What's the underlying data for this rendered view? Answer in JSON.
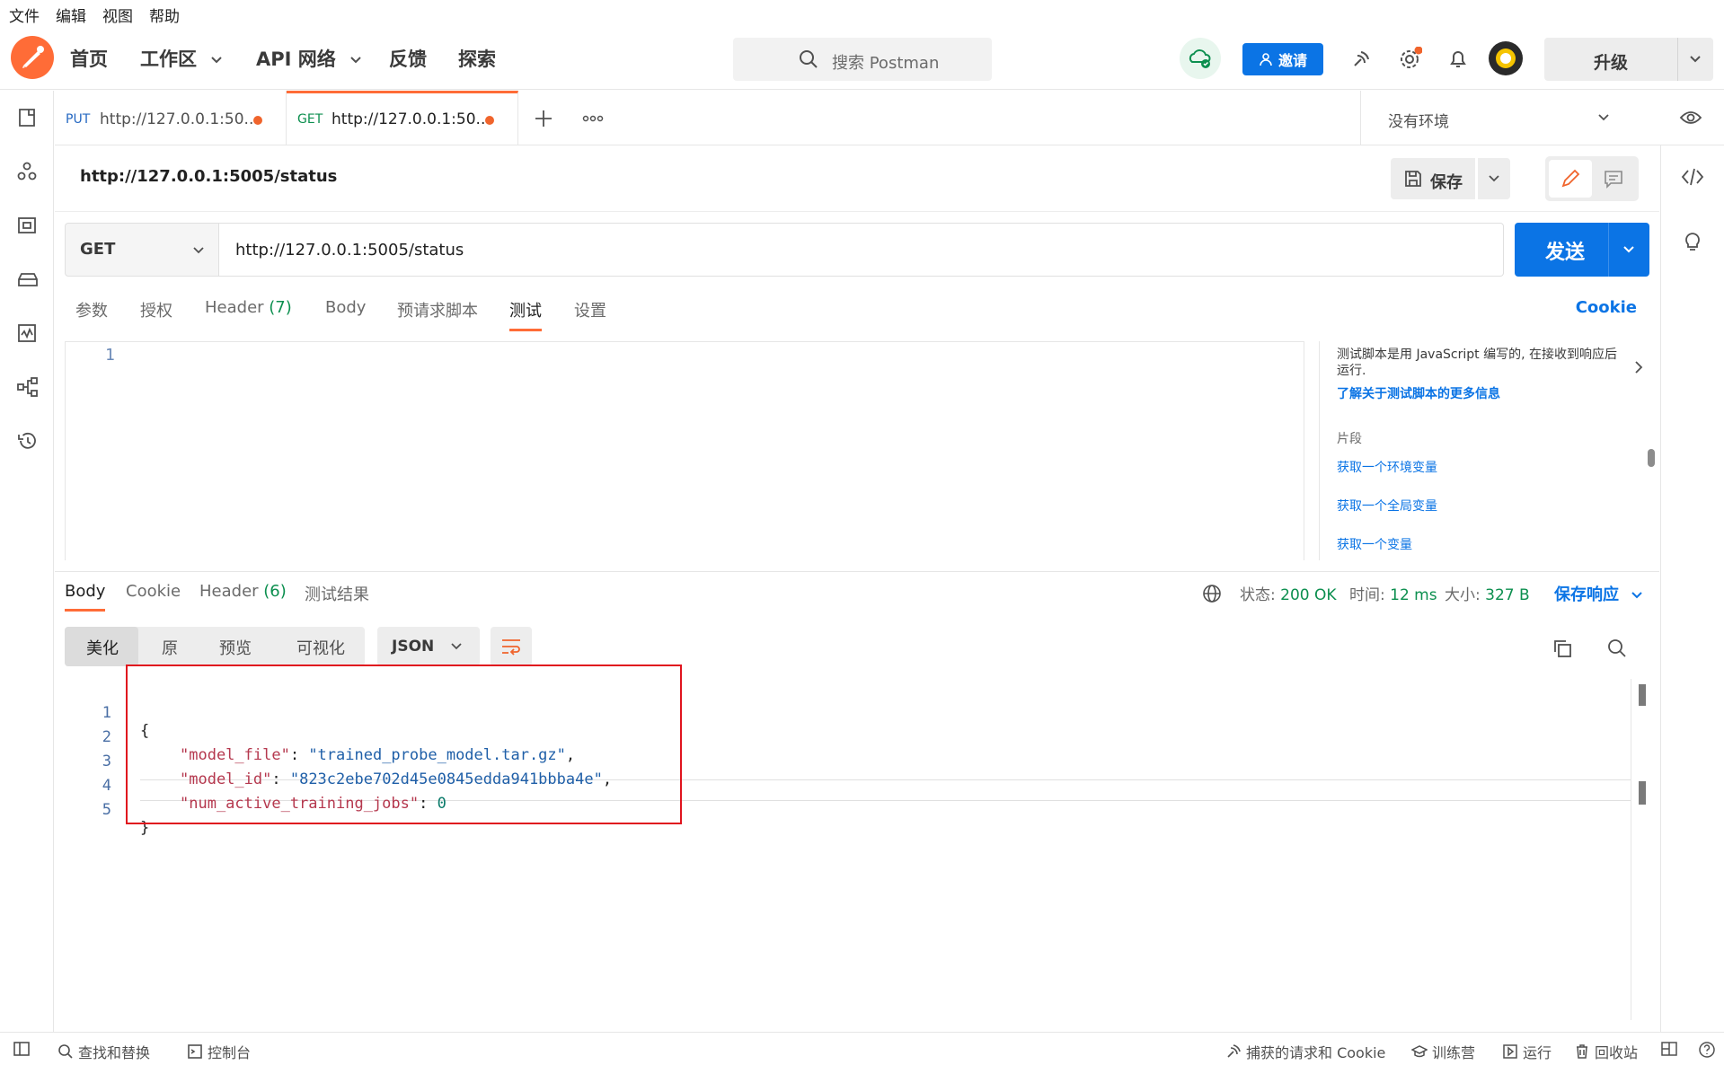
{
  "menubar": [
    "文件",
    "编辑",
    "视图",
    "帮助"
  ],
  "header": {
    "nav": [
      {
        "label": "首页",
        "dropdown": false
      },
      {
        "label": "工作区",
        "dropdown": true
      },
      {
        "label": "API 网络",
        "dropdown": true
      },
      {
        "label": "反馈",
        "dropdown": false
      },
      {
        "label": "探索",
        "dropdown": false
      }
    ],
    "search_placeholder": "搜索 Postman",
    "invite_label": "邀请",
    "upgrade_label": "升级"
  },
  "tabs": [
    {
      "method": "PUT",
      "url": "http://127.0.0.1:50...",
      "method_color": "#2568c2"
    },
    {
      "method": "GET",
      "url": "http://127.0.0.1:50...",
      "method_color": "#0c8f4f"
    }
  ],
  "environment": "没有环境",
  "request": {
    "title": "http://127.0.0.1:5005/status",
    "save_label": "保存",
    "method": "GET",
    "url": "http://127.0.0.1:5005/status",
    "send_label": "发送",
    "tabs": {
      "params": "参数",
      "auth": "授权",
      "header": "Header",
      "header_count": "(7)",
      "body": "Body",
      "prerequest": "预请求脚本",
      "tests": "测试",
      "settings": "设置"
    },
    "cookie_link": "Cookie"
  },
  "editor": {
    "line": "1"
  },
  "snippets": {
    "description": "测试脚本是用 JavaScript 编写的, 在接收到响应后运行.",
    "learn_more": "了解关于测试脚本的更多信息",
    "section_title": "片段",
    "items": [
      "获取一个环境变量",
      "获取一个全局变量",
      "获取一个变量"
    ]
  },
  "response": {
    "tabs": {
      "body": "Body",
      "cookie": "Cookie",
      "header": "Header",
      "header_count": "(6)",
      "test_results": "测试结果"
    },
    "status_label": "状态:",
    "status_value": "200 OK",
    "time_label": "时间:",
    "time_value": "12 ms",
    "size_label": "大小:",
    "size_value": "327 B",
    "save_response": "保存响应",
    "view_modes": [
      "美化",
      "原",
      "预览",
      "可视化"
    ],
    "format": "JSON",
    "line_numbers": [
      "1",
      "2",
      "3",
      "4",
      "5"
    ],
    "code": {
      "open": "{",
      "k1": "\"model_file\"",
      "v1": "\"trained_probe_model.tar.gz\"",
      "k2": "\"model_id\"",
      "v2": "\"823c2ebe702d45e0845edda941bbba4e\"",
      "k3": "\"num_active_training_jobs\"",
      "v3": "0",
      "close": "}"
    }
  },
  "statusbar": {
    "find_replace": "查找和替换",
    "console": "控制台",
    "capture": "捕获的请求和 Cookie",
    "bootcamp": "训练营",
    "runner": "运行",
    "trash": "回收站"
  }
}
